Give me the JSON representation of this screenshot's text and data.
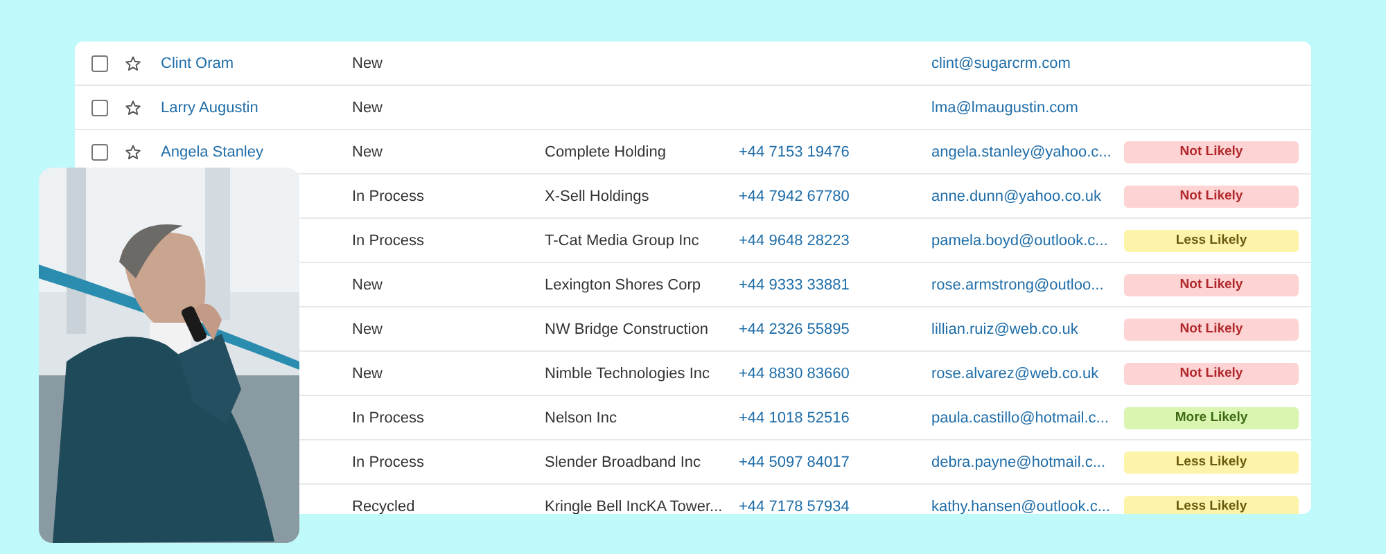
{
  "rows": [
    {
      "checked": false,
      "starred": false,
      "name": "Clint Oram",
      "status": "New",
      "email": "clint@sugarcrm.com"
    },
    {
      "checked": false,
      "starred": false,
      "name": "Larry Augustin",
      "status": "New",
      "email": "lma@lmaugustin.com"
    },
    {
      "checked": false,
      "starred": false,
      "name": "Angela Stanley",
      "status": "New",
      "account": "Complete Holding",
      "phone": "+44 7153 19476",
      "email": "angela.stanley@yahoo.c...",
      "likelihood": {
        "label": "Not Likely",
        "kind": "not"
      }
    },
    {
      "status": "In Process",
      "account": "X-Sell Holdings",
      "phone": "+44 7942 67780",
      "email": "anne.dunn@yahoo.co.uk",
      "likelihood": {
        "label": "Not Likely",
        "kind": "not"
      }
    },
    {
      "status": "In Process",
      "account": "T-Cat Media Group Inc",
      "phone": "+44 9648 28223",
      "email": "pamela.boyd@outlook.c...",
      "likelihood": {
        "label": "Less Likely",
        "kind": "less"
      }
    },
    {
      "status": "New",
      "account": "Lexington Shores Corp",
      "phone": "+44 9333 33881",
      "email": "rose.armstrong@outloo...",
      "likelihood": {
        "label": "Not Likely",
        "kind": "not"
      }
    },
    {
      "status": "New",
      "account": "NW Bridge Construction",
      "phone": "+44 2326 55895",
      "email": "lillian.ruiz@web.co.uk",
      "likelihood": {
        "label": "Not Likely",
        "kind": "not"
      }
    },
    {
      "status": "New",
      "account": "Nimble Technologies Inc",
      "phone": "+44 8830 83660",
      "email": "rose.alvarez@web.co.uk",
      "likelihood": {
        "label": "Not Likely",
        "kind": "not"
      }
    },
    {
      "status": "In Process",
      "account": "Nelson Inc",
      "phone": "+44 1018 52516",
      "email": "paula.castillo@hotmail.c...",
      "likelihood": {
        "label": "More Likely",
        "kind": "more"
      }
    },
    {
      "status": "In Process",
      "account": "Slender Broadband Inc",
      "phone": "+44 5097 84017",
      "email": "debra.payne@hotmail.c...",
      "likelihood": {
        "label": "Less Likely",
        "kind": "less"
      }
    },
    {
      "status": "Recycled",
      "account": "Kringle Bell IncKA Tower...",
      "phone": "+44 7178 57934",
      "email": "kathy.hansen@outlook.c...",
      "likelihood": {
        "label": "Less Likely",
        "kind": "less"
      }
    }
  ]
}
